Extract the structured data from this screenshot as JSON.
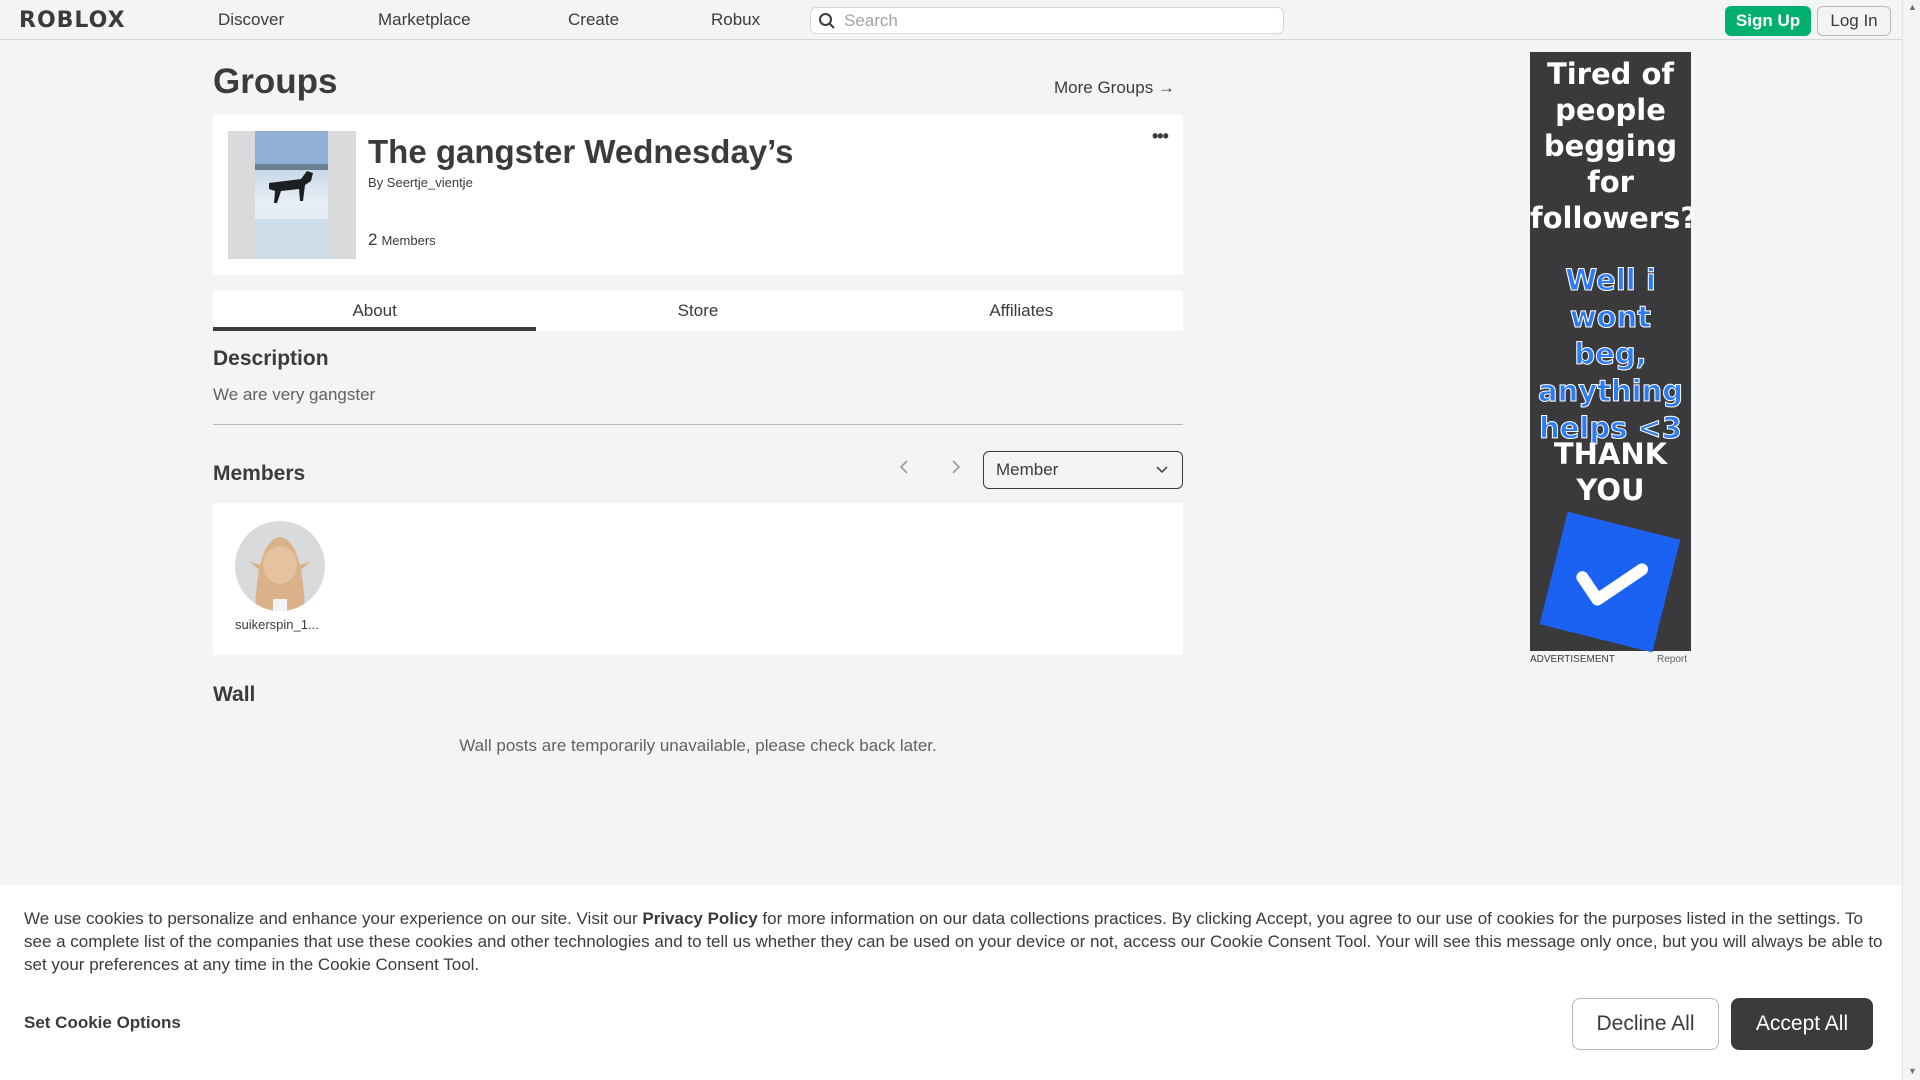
{
  "header": {
    "logo": "ROBLOX",
    "nav": [
      "Discover",
      "Marketplace",
      "Create",
      "Robux"
    ],
    "search_placeholder": "Search",
    "signup_label": "Sign Up",
    "login_label": "Log In"
  },
  "page": {
    "title": "Groups",
    "more_groups": "More Groups →"
  },
  "group": {
    "name": "The gangster Wednesday’s",
    "by_label": "By",
    "owner": "Seertje_vientje",
    "member_count": "2",
    "members_label": "Members",
    "menu_icon": "more-dots-icon"
  },
  "tabs": [
    {
      "label": "About",
      "active": true
    },
    {
      "label": "Store",
      "active": false
    },
    {
      "label": "Affiliates",
      "active": false
    }
  ],
  "about": {
    "description_heading": "Description",
    "description": "We are very gangster",
    "members_heading": "Members",
    "role_selected": "Member",
    "members": [
      {
        "name": "suikerspin_1..."
      }
    ],
    "wall_heading": "Wall",
    "wall_message": "Wall posts are temporarily unavailable, please check back later."
  },
  "ad": {
    "line1": [
      "Tired of",
      "people",
      "begging",
      "for",
      "followers?"
    ],
    "line2": [
      "Well i",
      "wont beg,",
      "anything",
      "helps <3"
    ],
    "line3": [
      "THANK",
      "YOU"
    ],
    "label": "ADVERTISEMENT",
    "report": "Report"
  },
  "cookie": {
    "text_before": "We use cookies to personalize and enhance your experience on our site. Visit our ",
    "privacy_link": "Privacy Policy",
    "text_after": " for more information on our data collections practices. By clicking Accept, you agree to our use of cookies for the purposes listed in the settings. To see a complete list of the companies that use these cookies and other technologies and to tell us whether they can be used on your device or not, access our Cookie Consent Tool. Your will see this message only once, but you will always be able to set your preferences at any time in the Cookie Consent Tool.",
    "options_label": "Set Cookie Options",
    "decline_label": "Decline All",
    "accept_label": "Accept All"
  },
  "colors": {
    "signup_green": "#00b06f",
    "text_dark": "#393b3d",
    "background": "#f2f4f5",
    "ad_blue": "#2d7cf6"
  }
}
